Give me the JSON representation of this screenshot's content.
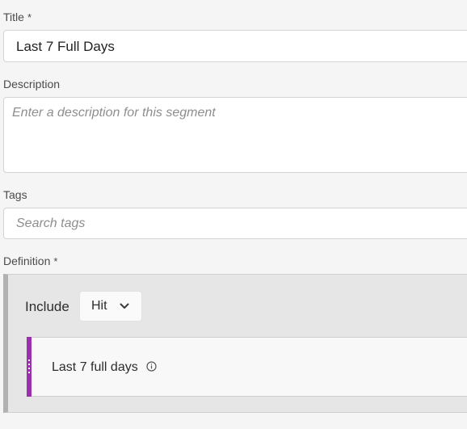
{
  "form": {
    "title": {
      "label": "Title",
      "required_mark": "*",
      "value": "Last 7 Full Days"
    },
    "description": {
      "label": "Description",
      "placeholder": "Enter a description for this segment",
      "value": ""
    },
    "tags": {
      "label": "Tags",
      "placeholder": "Search tags",
      "value": ""
    },
    "definition": {
      "label": "Definition",
      "required_mark": "*",
      "include_label": "Include",
      "scope_value": "Hit",
      "rule": {
        "label": "Last 7 full days",
        "icon": "info-icon",
        "handle_color": "#9b2fae"
      }
    }
  },
  "icons": {
    "dropdown": "chevron-down-icon",
    "drag": "drag-handle-icon"
  }
}
